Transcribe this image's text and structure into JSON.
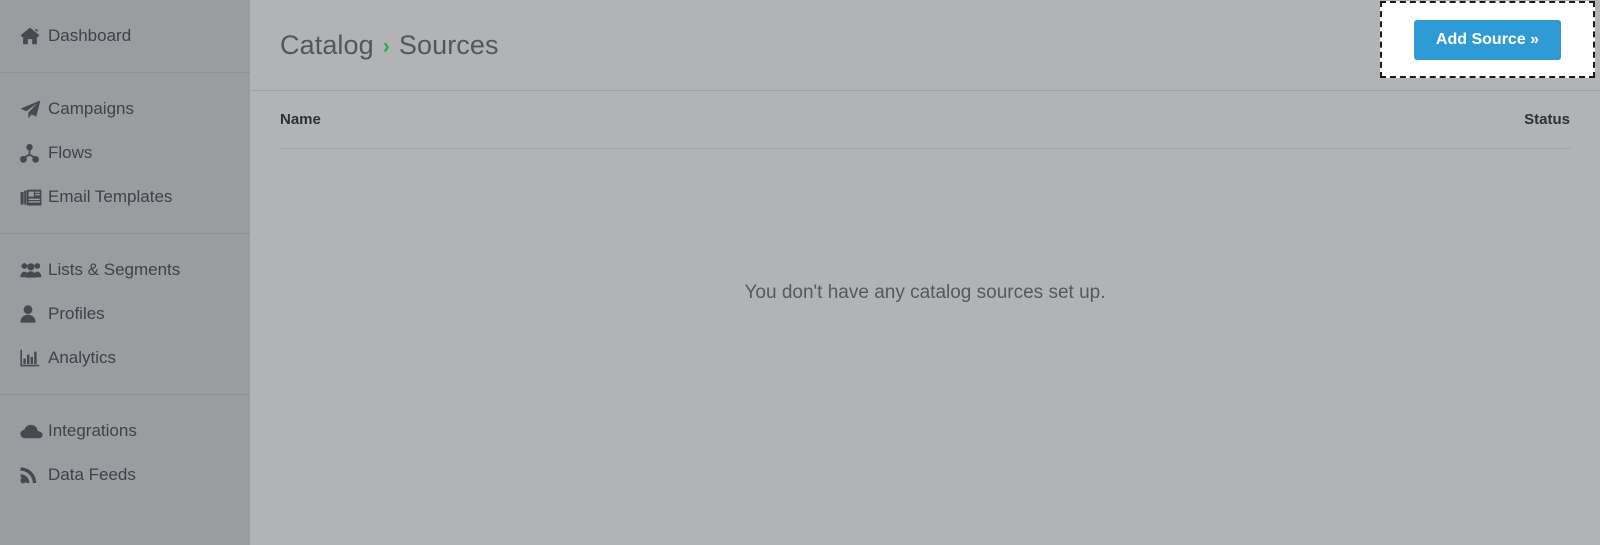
{
  "sidebar": {
    "groups": [
      {
        "items": [
          {
            "label": "Dashboard",
            "icon": "home-icon",
            "name": "dashboard"
          }
        ]
      },
      {
        "items": [
          {
            "label": "Campaigns",
            "icon": "paper-plane-icon",
            "name": "campaigns"
          },
          {
            "label": "Flows",
            "icon": "sitemap-icon",
            "name": "flows"
          },
          {
            "label": "Email Templates",
            "icon": "newspaper-icon",
            "name": "email-templates"
          }
        ]
      },
      {
        "items": [
          {
            "label": "Lists & Segments",
            "icon": "users-icon",
            "name": "lists-segments"
          },
          {
            "label": "Profiles",
            "icon": "user-icon",
            "name": "profiles"
          },
          {
            "label": "Analytics",
            "icon": "bar-chart-icon",
            "name": "analytics"
          }
        ]
      },
      {
        "items": [
          {
            "label": "Integrations",
            "icon": "cloud-icon",
            "name": "integrations"
          },
          {
            "label": "Data Feeds",
            "icon": "rss-icon",
            "name": "data-feeds"
          }
        ]
      }
    ]
  },
  "header": {
    "breadcrumb": {
      "parent": "Catalog",
      "separator": "›",
      "current": "Sources"
    },
    "add_source_label": "Add Source »"
  },
  "table": {
    "columns": {
      "name": "Name",
      "status": "Status"
    },
    "rows": [],
    "empty_message": "You don't have any catalog sources set up."
  },
  "colors": {
    "accent_blue": "#2f9bd4",
    "breadcrumb_green": "#2aa758",
    "sidebar_bg": "#9a9ca0",
    "main_bg": "#b2b3b4",
    "text_dark": "#3e4349"
  }
}
